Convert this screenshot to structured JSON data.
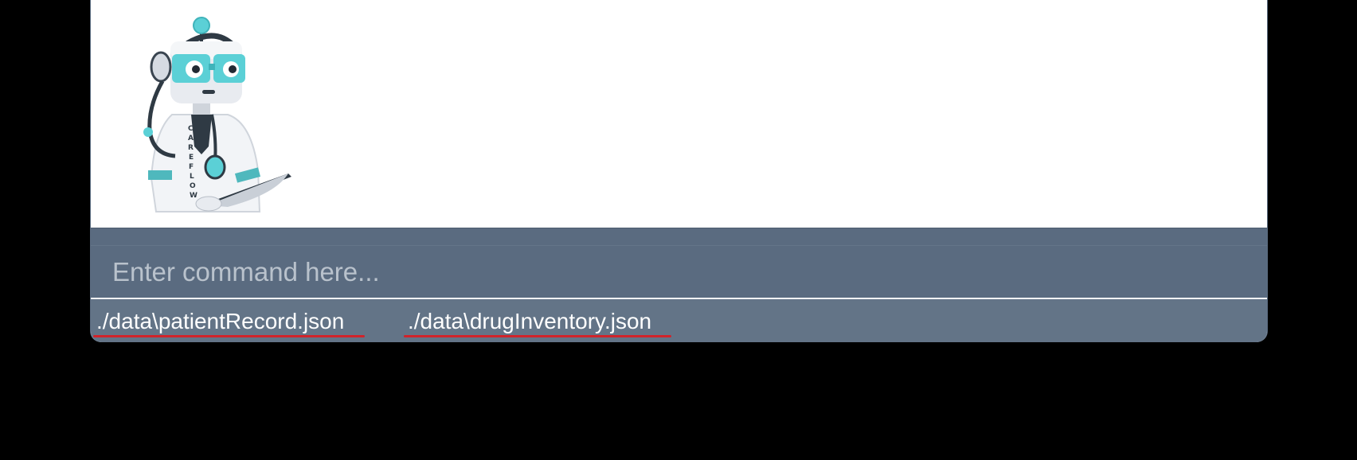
{
  "app": {
    "mascot_label": "CAREFLOW",
    "mascot_icon": "robot-doctor-icon"
  },
  "command": {
    "placeholder": "Enter command here...",
    "value": ""
  },
  "status_bar": {
    "files": [
      {
        "path": "./data\\patientRecord.json"
      },
      {
        "path": "./data\\drugInventory.json"
      }
    ]
  },
  "colors": {
    "panel": "#5a6b80",
    "status_bar": "#637487",
    "accent": "#5bd0d6",
    "error_underline": "#d1232a"
  }
}
